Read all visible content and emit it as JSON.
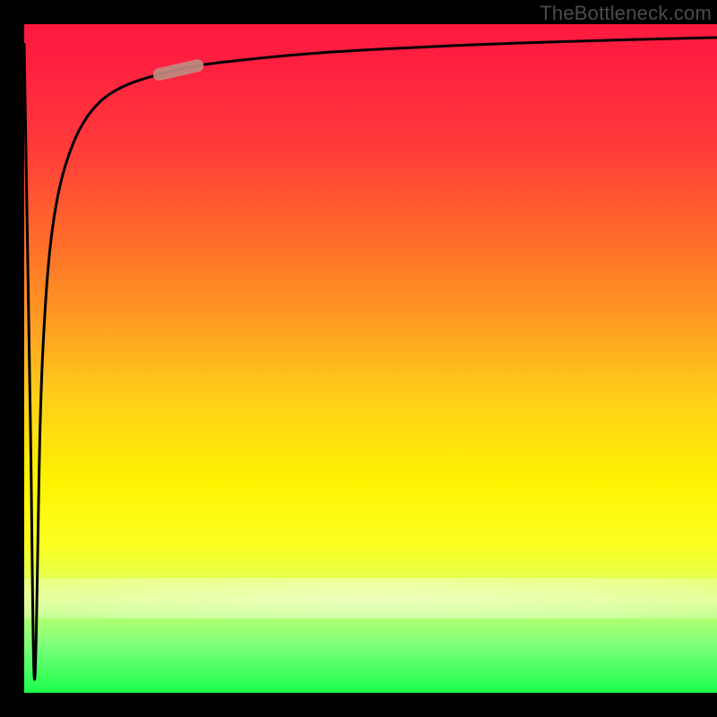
{
  "watermark": "TheBottleneck.com",
  "colors": {
    "background": "#000000",
    "curve": "#000000",
    "highlight": "#bf8a80"
  },
  "chart_data": {
    "type": "line",
    "title": "",
    "xlabel": "",
    "ylabel": "",
    "xlim": [
      0,
      100
    ],
    "ylim": [
      0,
      100
    ],
    "x": [
      0.0,
      0.9,
      1.5,
      2.3,
      3.0,
      3.9,
      5.2,
      7.0,
      9.0,
      11.6,
      15.0,
      19.5,
      25.0,
      32.0,
      40.0,
      50.0,
      62.0,
      75.0,
      88.0,
      100.0
    ],
    "values": [
      97.0,
      40.0,
      2.0,
      40.0,
      57.0,
      68.0,
      76.0,
      82.0,
      86.0,
      89.0,
      91.0,
      92.5,
      93.8,
      94.7,
      95.5,
      96.2,
      96.8,
      97.3,
      97.7,
      98.0
    ],
    "highlight_segment": {
      "x0": 19.5,
      "x1": 25.0
    }
  }
}
